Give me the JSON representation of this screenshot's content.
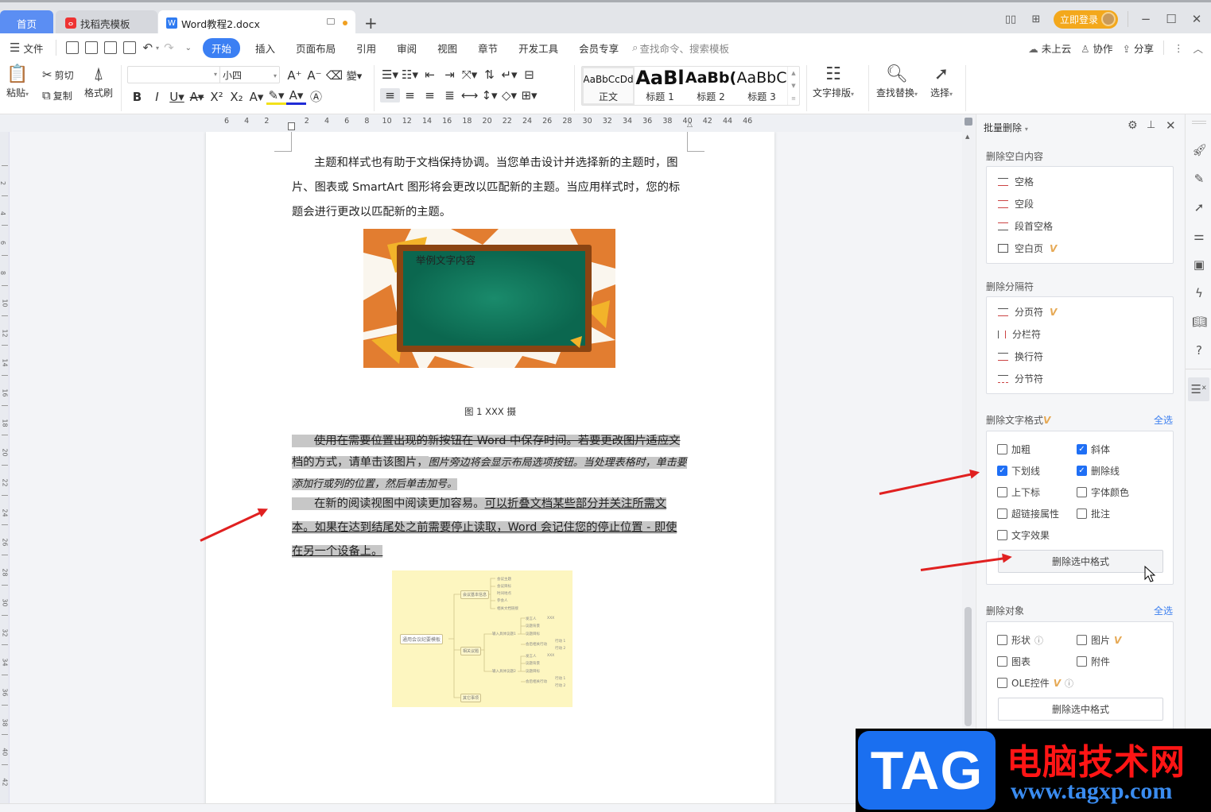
{
  "titlebar": {
    "tabs": [
      {
        "label": "首页",
        "icon": "home"
      },
      {
        "label": "找稻壳模板",
        "icon": "daoke-logo-icon"
      },
      {
        "label": "Word教程2.docx",
        "icon": "word-doc-icon",
        "unsaved": true
      }
    ],
    "add_tab": "+",
    "login_button": "立即登录",
    "window_controls": [
      "layout-icon",
      "grid-apps-icon",
      "minimize",
      "maximize",
      "close"
    ]
  },
  "menubar": {
    "file": "文件",
    "quick_icons": [
      "save-icon",
      "export-icon",
      "print-icon",
      "print-preview-icon",
      "undo-icon",
      "redo-icon",
      "more-icon"
    ],
    "tabs": [
      "开始",
      "插入",
      "页面布局",
      "引用",
      "审阅",
      "视图",
      "章节",
      "开发工具",
      "会员专享"
    ],
    "active_tab": "开始",
    "search_placeholder": "查找命令、搜索模板",
    "right": {
      "cloud": "未上云",
      "collab": "协作",
      "share": "分享"
    }
  },
  "ribbon": {
    "clipboard": {
      "paste": "粘贴",
      "cut": "剪切",
      "copy": "复制",
      "format_painter": "格式刷"
    },
    "font": {
      "name": "",
      "size": "小四"
    },
    "styles": [
      {
        "preview": "AaBbCcDd",
        "label": "正文"
      },
      {
        "preview": "AaBl",
        "label": "标题 1"
      },
      {
        "preview": "AaBb(",
        "label": "标题 2"
      },
      {
        "preview": "AaBbC",
        "label": "标题 3"
      }
    ],
    "text_layout": "文字排版",
    "find_replace": "查找替换",
    "select": "选择"
  },
  "ruler": {
    "h_ticks": [
      "6",
      "4",
      "2",
      "",
      "2",
      "4",
      "6",
      "8",
      "10",
      "12",
      "14",
      "16",
      "18",
      "20",
      "22",
      "24",
      "26",
      "28",
      "30",
      "32",
      "34",
      "36",
      "38",
      "40",
      "42",
      "44",
      "46"
    ],
    "v_ticks": [
      "2",
      "4",
      "6",
      "8",
      "10",
      "12",
      "14",
      "16",
      "18",
      "20",
      "22",
      "24",
      "26",
      "28",
      "30",
      "32",
      "34",
      "36",
      "38",
      "40",
      "42"
    ]
  },
  "document": {
    "para1": "主题和样式也有助于文档保持协调。当您单击设计并选择新的主题时，图片、图表或 SmartArt 图形将会更改以匹配新的主题。当应用样式时，您的标题会进行更改以匹配新的主题。",
    "image_text": "举例文字内容",
    "caption": "图 1   XXX 摄",
    "para2_strike": "使用在需要位置出现的新按钮在 Word 中保存时间。若要更改图片适应文",
    "para2_normal": "档的方式，请单击该图片，",
    "para2_italic": "图片旁边将会显示布局选项按钮。当处理表格时，单击要添加行或列的位置，然后单击加号。",
    "para3_normal": "在新的阅读视图中阅读更加容易。",
    "para3_underline": "可以折叠文档某些部分并关注所需文本。如果在达到结尾处之前需要停止读取，Word 会记住您的停止位置 - 即使在另一个设备上。",
    "mindmap": {
      "root": "通用会议纪要模板",
      "branches": [
        "会议基本信息",
        "相关议题",
        "其它事项"
      ],
      "info_leaves": [
        "会议主题",
        "会议目标",
        "时间地点",
        "参会人",
        "相关文档链接"
      ],
      "topics": [
        "输入具体议题1",
        "输入具体议题2"
      ],
      "topic_leaves": [
        "发言人",
        "议题背景",
        "议题目标",
        "会后相关行动"
      ],
      "speaker": "XXX",
      "actions": [
        "行动 1",
        "行动 2"
      ]
    }
  },
  "panel": {
    "title": "批量删除",
    "sections": {
      "blank": {
        "title": "删除空白内容",
        "items": [
          {
            "label": "空格",
            "vip": false
          },
          {
            "label": "空段",
            "vip": false
          },
          {
            "label": "段首空格",
            "vip": false
          },
          {
            "label": "空白页",
            "vip": true
          }
        ]
      },
      "separators": {
        "title": "删除分隔符",
        "items": [
          {
            "label": "分页符",
            "vip": true
          },
          {
            "label": "分栏符",
            "vip": false
          },
          {
            "label": "换行符",
            "vip": false
          },
          {
            "label": "分节符",
            "vip": false
          }
        ]
      },
      "text_format": {
        "title": "删除文字格式",
        "vip": true,
        "select_all": "全选",
        "checkboxes": [
          {
            "label": "加粗",
            "checked": false
          },
          {
            "label": "斜体",
            "checked": true
          },
          {
            "label": "下划线",
            "checked": true
          },
          {
            "label": "删除线",
            "checked": true
          },
          {
            "label": "上下标",
            "checked": false
          },
          {
            "label": "字体颜色",
            "checked": false
          },
          {
            "label": "超链接属性",
            "checked": false
          },
          {
            "label": "批注",
            "checked": false
          },
          {
            "label": "文字效果",
            "checked": false
          }
        ],
        "button": "删除选中格式"
      },
      "objects": {
        "title": "删除对象",
        "select_all": "全选",
        "checkboxes": [
          {
            "label": "形状",
            "checked": false,
            "info": true
          },
          {
            "label": "图片",
            "checked": false,
            "vip": true
          },
          {
            "label": "图表",
            "checked": false
          },
          {
            "label": "附件",
            "checked": false
          },
          {
            "label": "OLE控件",
            "checked": false,
            "vip": true,
            "info": true
          }
        ],
        "button": "删除选中格式"
      }
    },
    "vip_mark": "V"
  },
  "right_sidebar": [
    "rocket-icon",
    "pen-icon",
    "pointer-icon",
    "sliders-icon",
    "image-tools-icon",
    "lightning-icon",
    "book-search-icon",
    "help-icon",
    "batch-delete-icon"
  ],
  "watermark": {
    "tag": "TAG",
    "cn": "电脑技术网",
    "url": "www.tagxp.com"
  }
}
